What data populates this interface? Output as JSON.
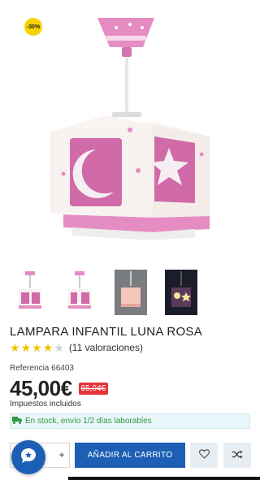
{
  "badge": {
    "discount": "-30%"
  },
  "colors": {
    "accent": "#1d5fb5",
    "badge": "#f6d200",
    "old_price_bg": "#e4333a",
    "stock_text": "#2f9a3c",
    "lamp_pink": "#e58dc3"
  },
  "gallery": {
    "thumbnails": [
      {
        "label": "lamp-front-view"
      },
      {
        "label": "lamp-side-view"
      },
      {
        "label": "lamp-lit-view"
      },
      {
        "label": "lamp-night-view"
      }
    ]
  },
  "product": {
    "title": "LAMPARA INFANTIL LUNA ROSA",
    "rating_value": 4,
    "rating_max": 5,
    "reviews": "(11 valoraciones)",
    "reference": "Referencia 66403",
    "price": "45,00€",
    "old_price": "65,04€",
    "taxes": "Impuestos incluidos",
    "stock": "En stock, envío 1/2 días laborables"
  },
  "actions": {
    "qty_plus": "+",
    "add_to_cart": "AÑADIR AL CARRITO"
  },
  "icons": {
    "wishlist": "heart-icon",
    "compare": "shuffle-icon",
    "chat": "chat-icon",
    "stock": "truck-icon"
  }
}
